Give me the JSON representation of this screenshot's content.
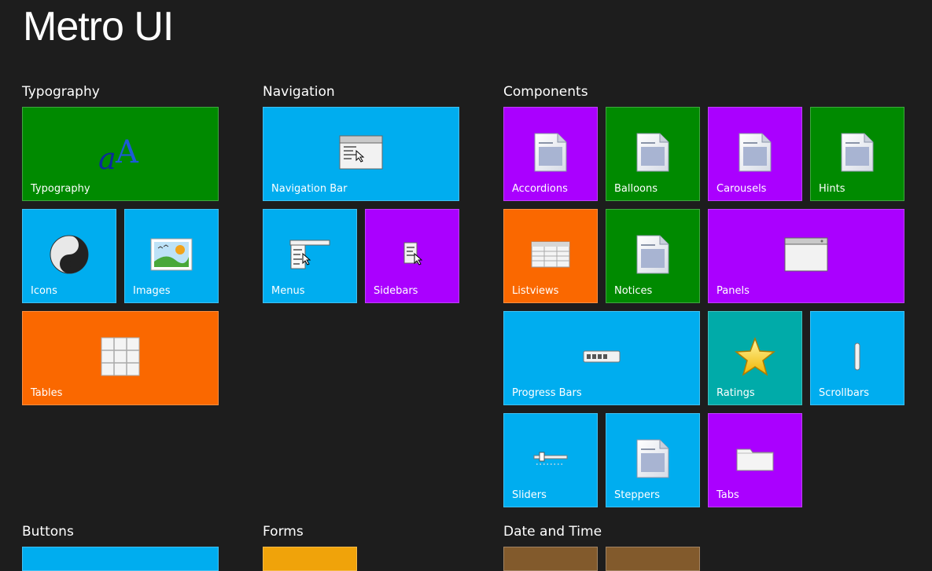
{
  "app": {
    "title": "Metro UI"
  },
  "groups": {
    "typography": "Typography",
    "navigation": "Navigation",
    "components": "Components",
    "buttons": "Buttons",
    "forms": "Forms",
    "datetime": "Date and Time"
  },
  "tiles": {
    "typography": "Typography",
    "icons": "Icons",
    "images": "Images",
    "tables": "Tables",
    "navigation_bar": "Navigation Bar",
    "menus": "Menus",
    "sidebars": "Sidebars",
    "accordions": "Accordions",
    "balloons": "Balloons",
    "carousels": "Carousels",
    "hints": "Hints",
    "listviews": "Listviews",
    "notices": "Notices",
    "panels": "Panels",
    "progress_bars": "Progress Bars",
    "ratings": "Ratings",
    "scrollbars": "Scrollbars",
    "sliders": "Sliders",
    "steppers": "Steppers",
    "tabs": "Tabs"
  },
  "colors": {
    "background": "#1d1d1d",
    "blue": "#00adef",
    "green": "#008a00",
    "purple": "#aa00ff",
    "orange": "#fa6800",
    "teal": "#00aba9",
    "amber": "#f0a30a",
    "brown": "#825a2c"
  }
}
